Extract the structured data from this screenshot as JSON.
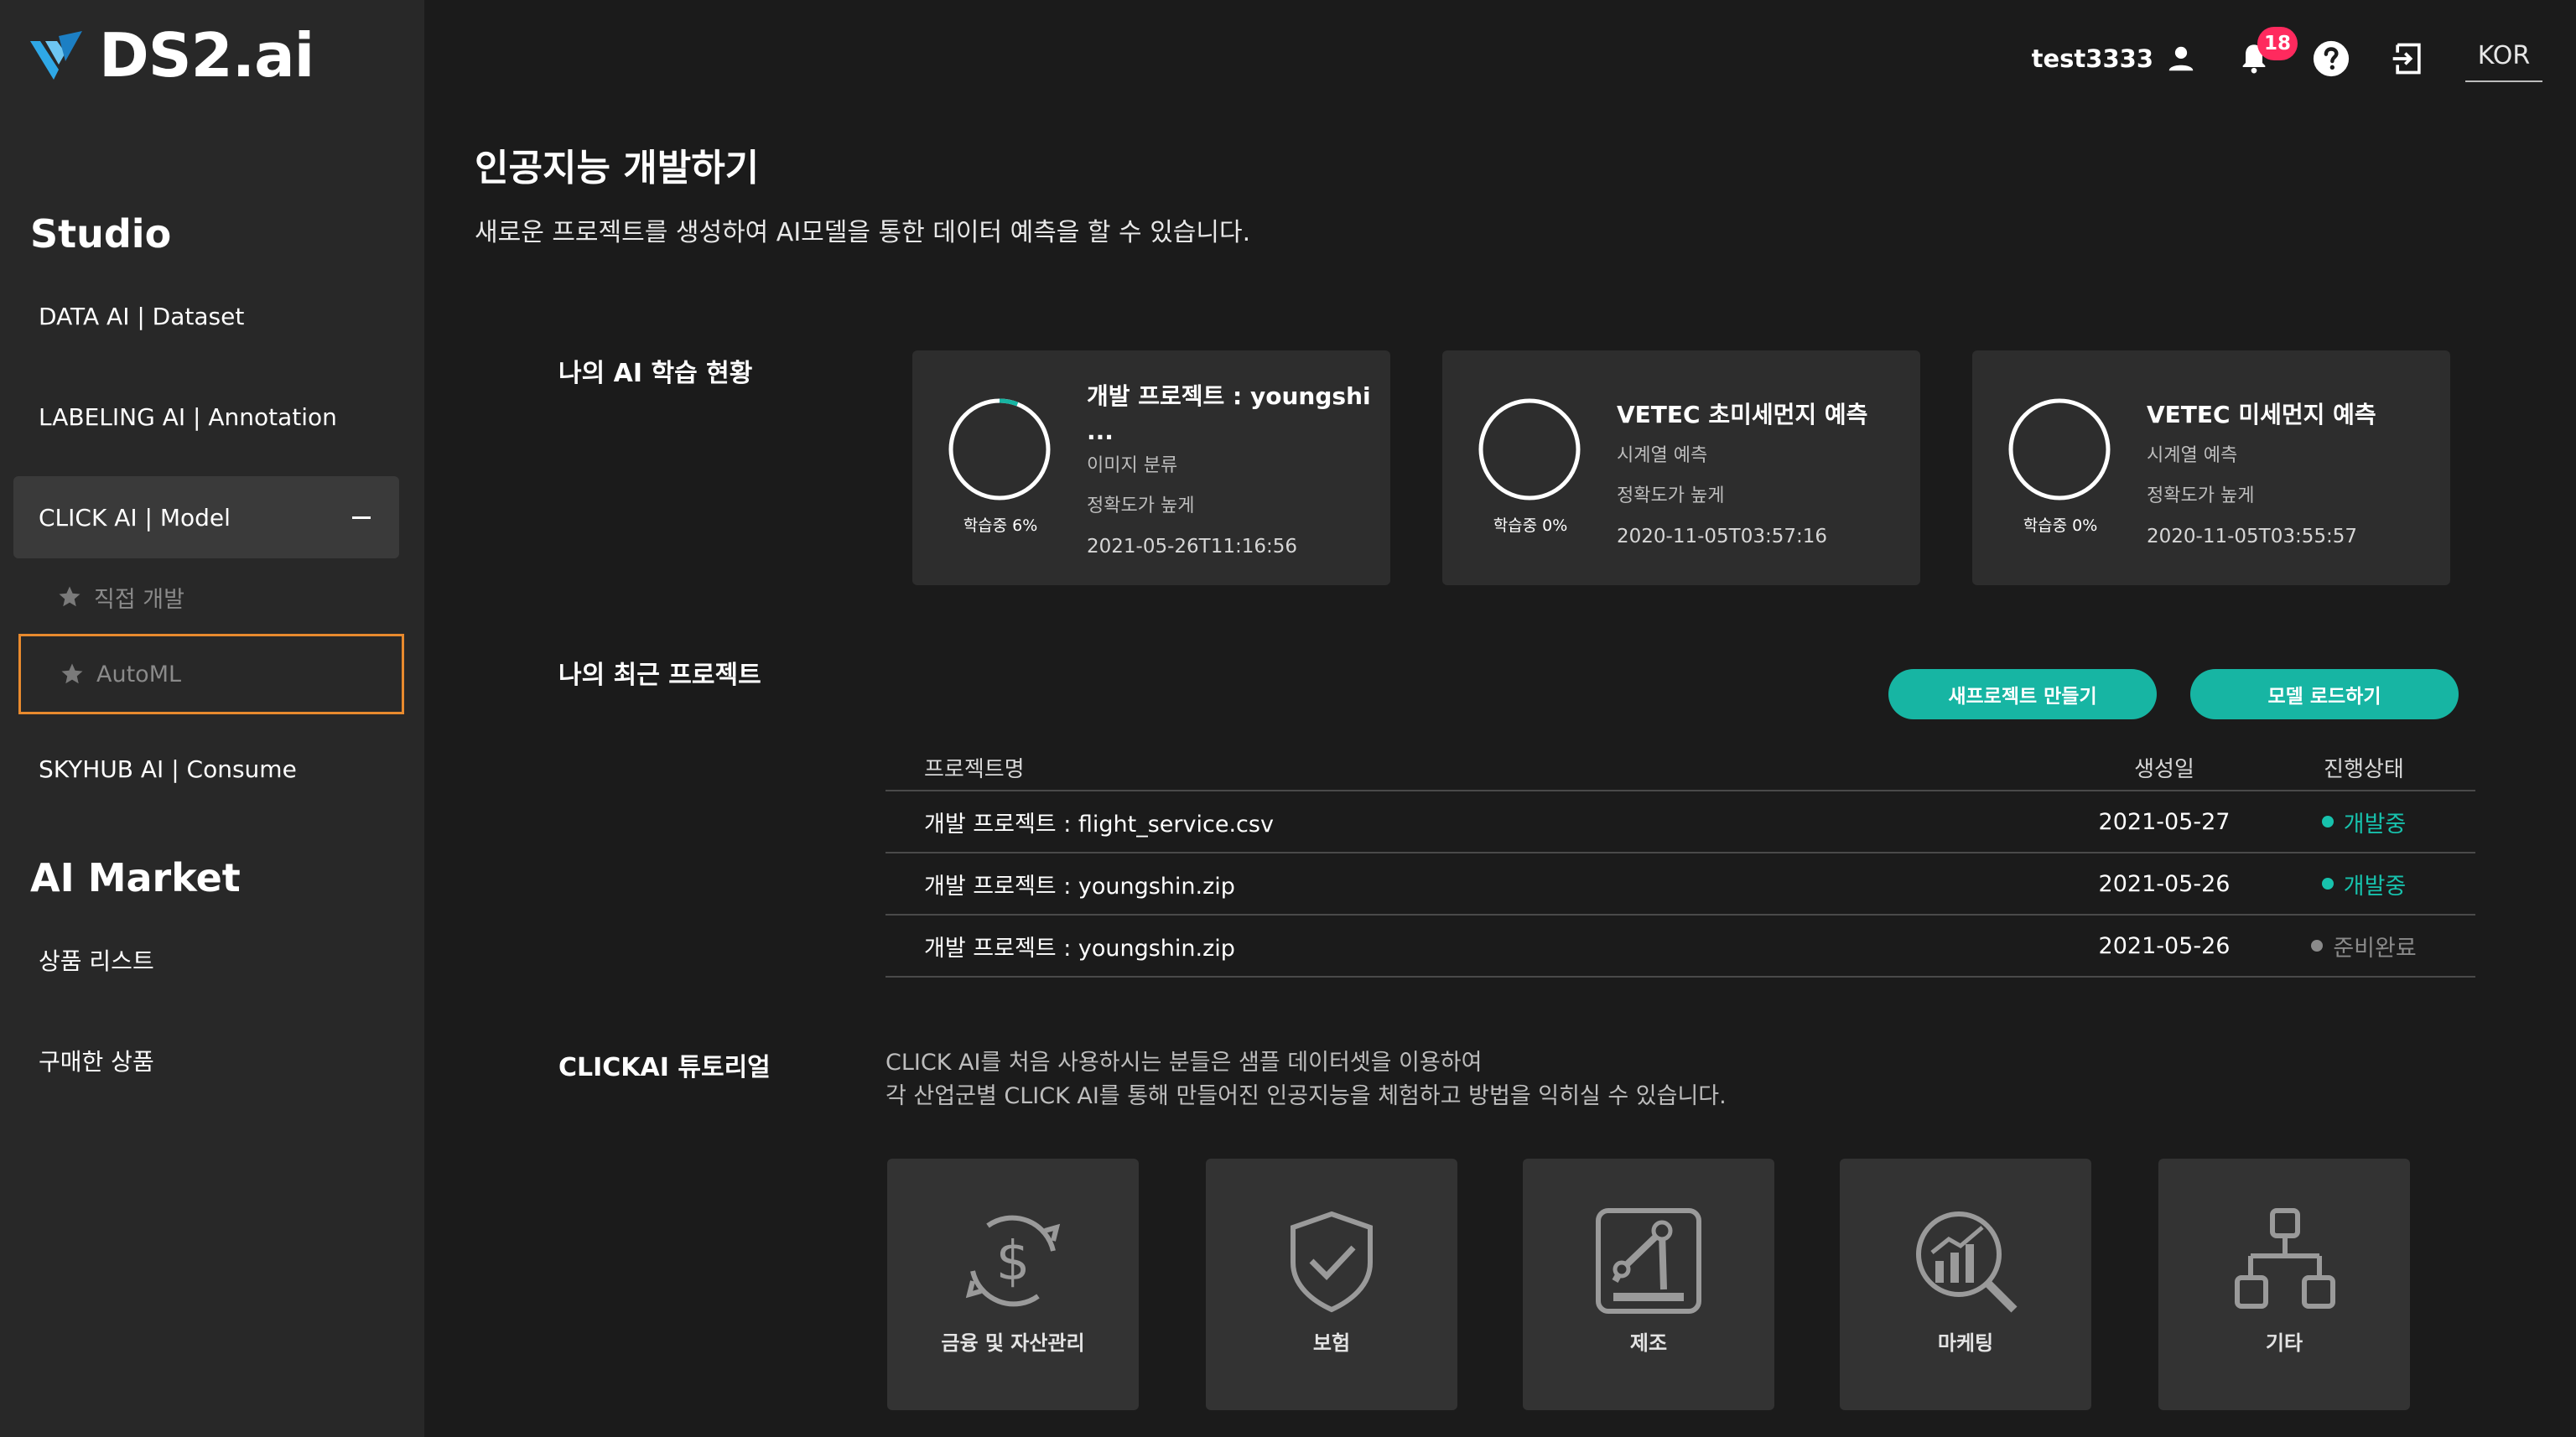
{
  "brand": {
    "name": "DS2.ai"
  },
  "sidebar": {
    "studio_title": "Studio",
    "items": [
      {
        "label": "DATA AI | Dataset"
      },
      {
        "label": "LABELING AI | Annotation"
      },
      {
        "label": "CLICK AI | Model"
      },
      {
        "label": "SKYHUB AI | Consume"
      }
    ],
    "sub_items": [
      {
        "label": "직접 개발"
      },
      {
        "label": "AutoML"
      }
    ],
    "market_title": "AI Market",
    "market_items": [
      {
        "label": "상품 리스트"
      },
      {
        "label": "구매한 상품"
      }
    ]
  },
  "header": {
    "username": "test3333",
    "notification_count": "18",
    "language": "KOR"
  },
  "main": {
    "title": "인공지능 개발하기",
    "description": "새로운 프로젝트를 생성하여 AI모델을 통한 데이터 예측을 할 수 있습니다.",
    "learning_status_title": "나의 AI 학습 현황",
    "status_cards": [
      {
        "title": "개발 프로젝트 : youngshi",
        "title2": "...",
        "type": "이미지 분류",
        "goal": "정확도가 높게",
        "date": "2021-05-26T11:16:56",
        "progress_label": "학습중 6%",
        "progress": 6
      },
      {
        "title": "VETEC 초미세먼지 예측",
        "title2": "",
        "type": "시계열 예측",
        "goal": "정확도가 높게",
        "date": "2020-11-05T03:57:16",
        "progress_label": "학습중 0%",
        "progress": 0
      },
      {
        "title": "VETEC 미세먼지 예측",
        "title2": "",
        "type": "시계열 예측",
        "goal": "정확도가 높게",
        "date": "2020-11-05T03:55:57",
        "progress_label": "학습중 0%",
        "progress": 0
      }
    ],
    "recent_title": "나의 최근 프로젝트",
    "new_project_button": "새프로젝트 만들기",
    "load_model_button": "모델 로드하기",
    "table": {
      "headers": {
        "name": "프로젝트명",
        "date": "생성일",
        "status": "진행상태"
      },
      "rows": [
        {
          "name": "개발 프로젝트 : flight_service.csv",
          "date": "2021-05-27",
          "status": "개발중"
        },
        {
          "name": "개발 프로젝트 : youngshin.zip",
          "date": "2021-05-26",
          "status": "개발중"
        },
        {
          "name": "개발 프로젝트 : youngshin.zip",
          "date": "2021-05-26",
          "status": "준비완료"
        }
      ]
    },
    "tutorial_title": "CLICKAI 튜토리얼",
    "tutorial_desc_line1": "CLICK AI를 처음 사용하시는 분들은 샘플 데이터셋을 이용하여",
    "tutorial_desc_line2": "각 산업군별 CLICK AI를 통해 만들어진 인공지능을 체험하고 방법을 익히실 수 있습니다.",
    "tutorials": [
      {
        "label": "금융 및 자산관리",
        "icon": "finance-icon"
      },
      {
        "label": "보험",
        "icon": "insurance-shield-icon"
      },
      {
        "label": "제조",
        "icon": "manufacturing-robot-arm-icon"
      },
      {
        "label": "마케팅",
        "icon": "marketing-chart-icon"
      },
      {
        "label": "기타",
        "icon": "hierarchy-icon"
      }
    ]
  },
  "colors": {
    "accent": "#17b5a3",
    "status_dev": "#17c2ad",
    "status_ready": "#8a8a8a",
    "selected_border": "#e88a2e",
    "badge": "#ff2a5e"
  }
}
